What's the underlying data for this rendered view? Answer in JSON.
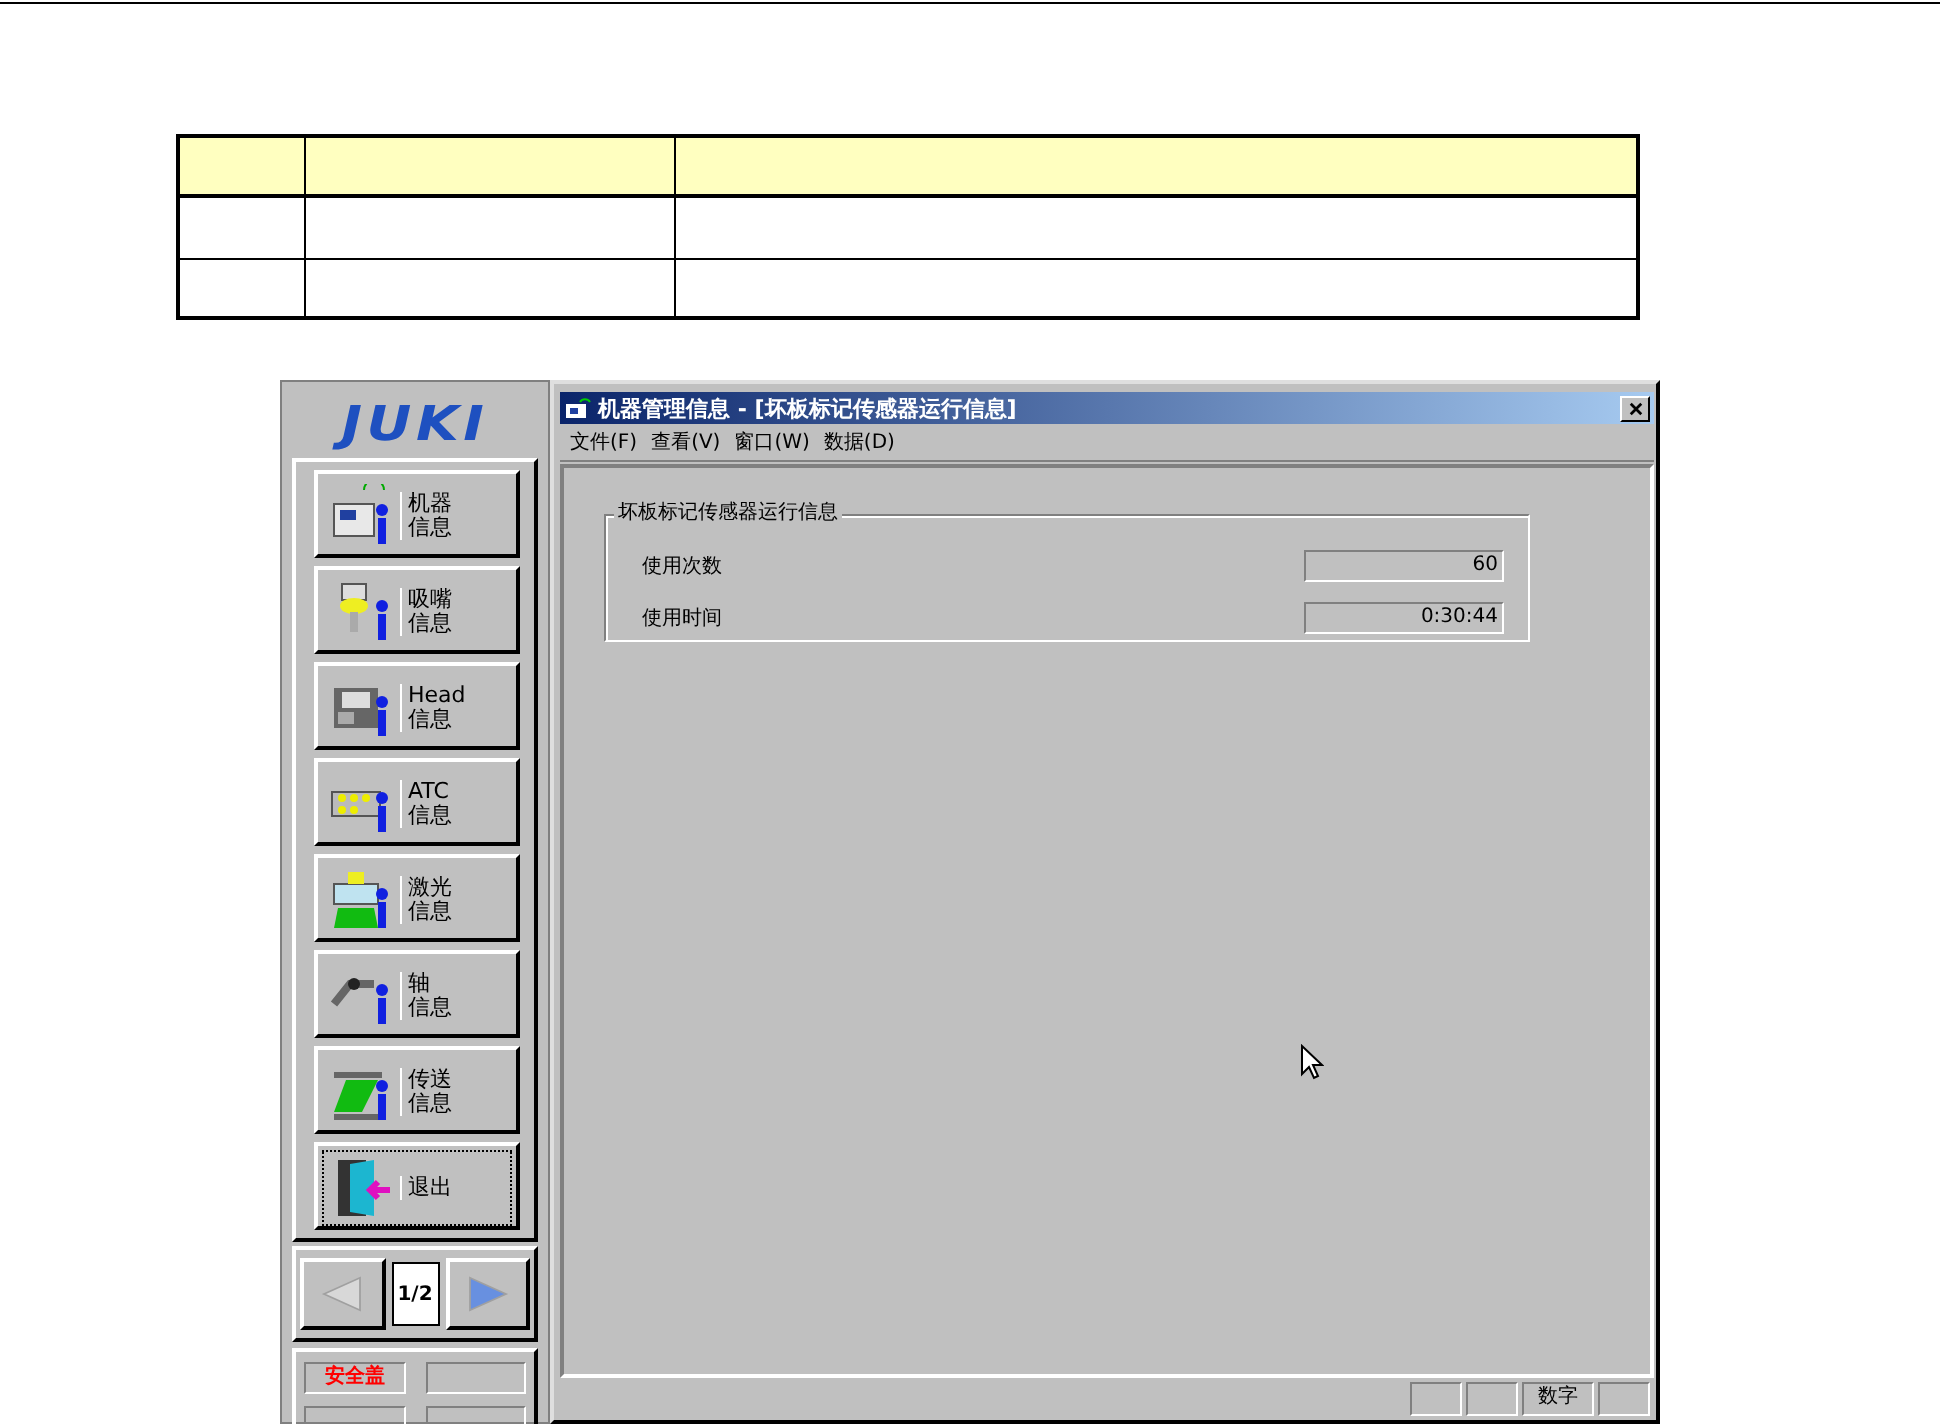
{
  "logo": "JUKI",
  "side_buttons": [
    {
      "kind": "machine",
      "lines": [
        "机器",
        "信息"
      ],
      "focused": false
    },
    {
      "kind": "nozzle",
      "lines": [
        "吸嘴",
        "信息"
      ],
      "focused": false
    },
    {
      "kind": "head",
      "lines": [
        "Head",
        "信息"
      ],
      "focused": false
    },
    {
      "kind": "atc",
      "lines": [
        "ATC",
        "信息"
      ],
      "focused": false
    },
    {
      "kind": "laser",
      "lines": [
        "激光",
        "信息"
      ],
      "focused": false
    },
    {
      "kind": "axis",
      "lines": [
        "轴",
        "信息"
      ],
      "focused": false
    },
    {
      "kind": "conveyor",
      "lines": [
        "传送",
        "信息"
      ],
      "focused": false
    },
    {
      "kind": "exit",
      "lines": [
        "退出"
      ],
      "focused": true
    }
  ],
  "pager": {
    "prev_disabled": true,
    "next_disabled": false,
    "page": "1/2"
  },
  "side_status": [
    "安全盖"
  ],
  "window": {
    "title": "机器管理信息 - [坏板标记传感器运行信息]",
    "menu": [
      "文件(F)",
      "查看(V)",
      "窗口(W)",
      "数据(D)"
    ],
    "group": {
      "title": "坏板标记传感器运行信息",
      "fields": [
        {
          "label": "使用次数",
          "value": "60"
        },
        {
          "label": "使用时间",
          "value": "0:30:44"
        }
      ]
    },
    "status_bar": [
      "数字"
    ]
  }
}
